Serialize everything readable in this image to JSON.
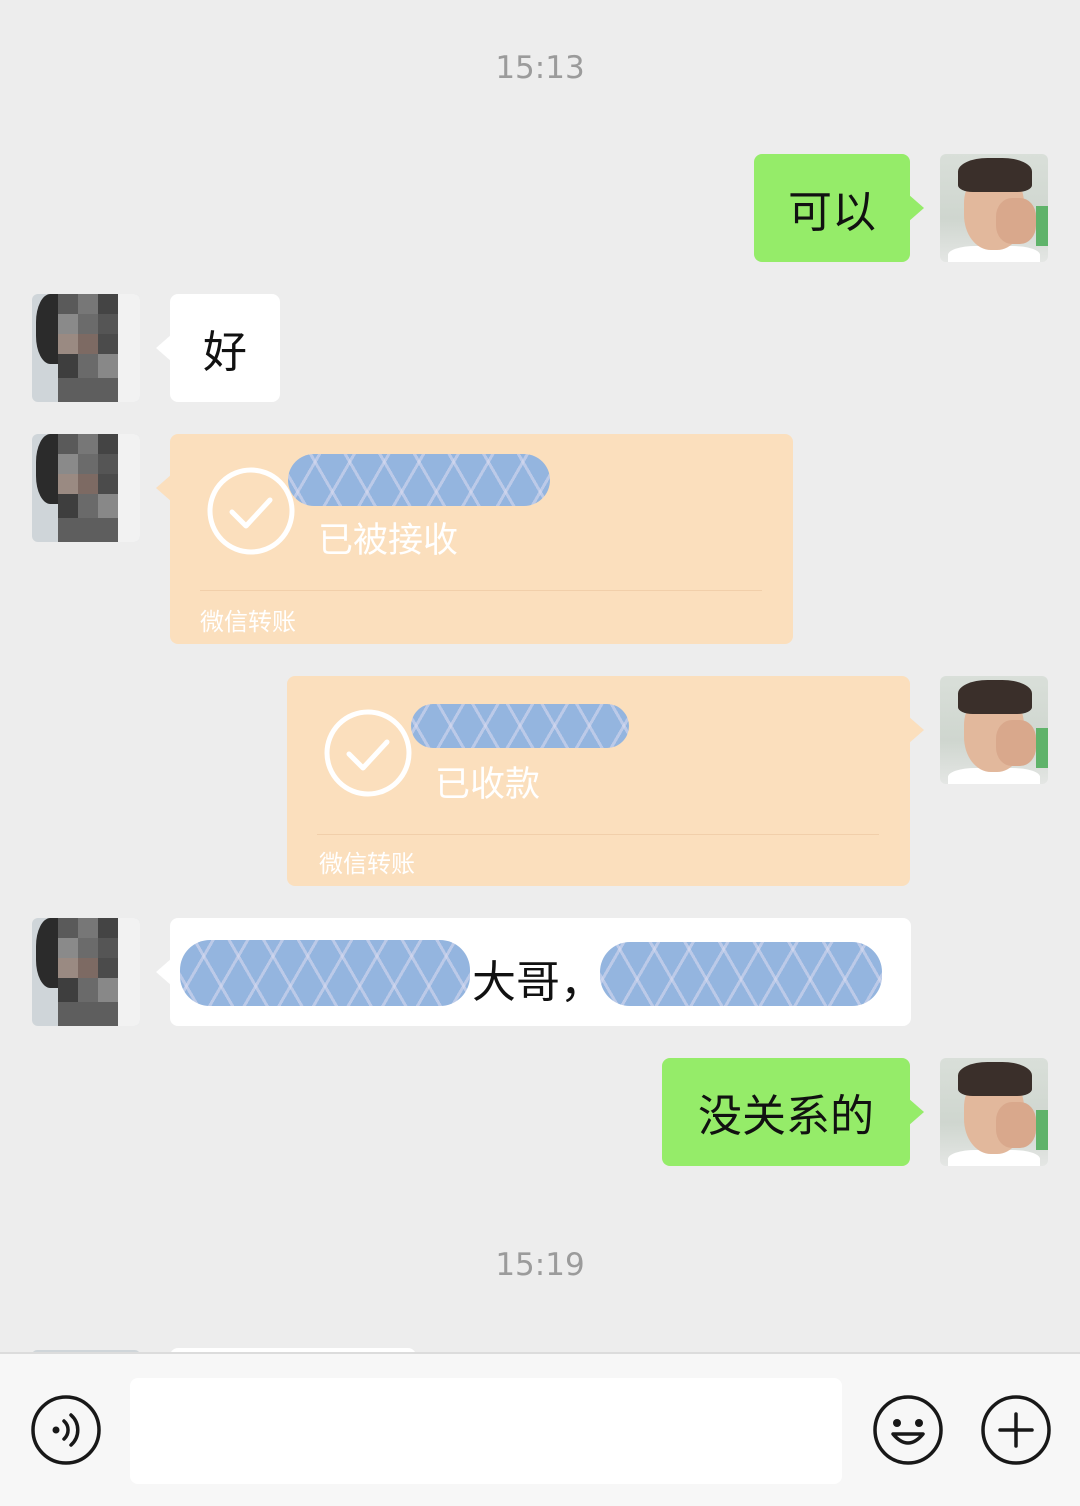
{
  "chat": {
    "timestamps": [
      "15:13",
      "15:19"
    ],
    "messages": [
      {
        "sender": "self",
        "type": "text",
        "text": "可以"
      },
      {
        "sender": "other",
        "type": "text",
        "text": "好"
      },
      {
        "sender": "other",
        "type": "transfer",
        "status": "已被接收",
        "brand": "微信转账"
      },
      {
        "sender": "self",
        "type": "transfer",
        "status": "已收款",
        "brand": "微信转账"
      },
      {
        "sender": "other",
        "type": "text",
        "text": "大哥，",
        "redacted": true
      },
      {
        "sender": "self",
        "type": "text",
        "text": "没关系的"
      }
    ]
  },
  "input_bar": {
    "voice_icon": "voice-icon",
    "emoji_icon": "emoji-icon",
    "plus_icon": "plus-icon",
    "input_value": ""
  },
  "colors": {
    "background": "#ededed",
    "self_bubble": "#95ec69",
    "other_bubble": "#ffffff",
    "transfer_card": "#fbdfbd",
    "redaction": "#94b5df"
  }
}
